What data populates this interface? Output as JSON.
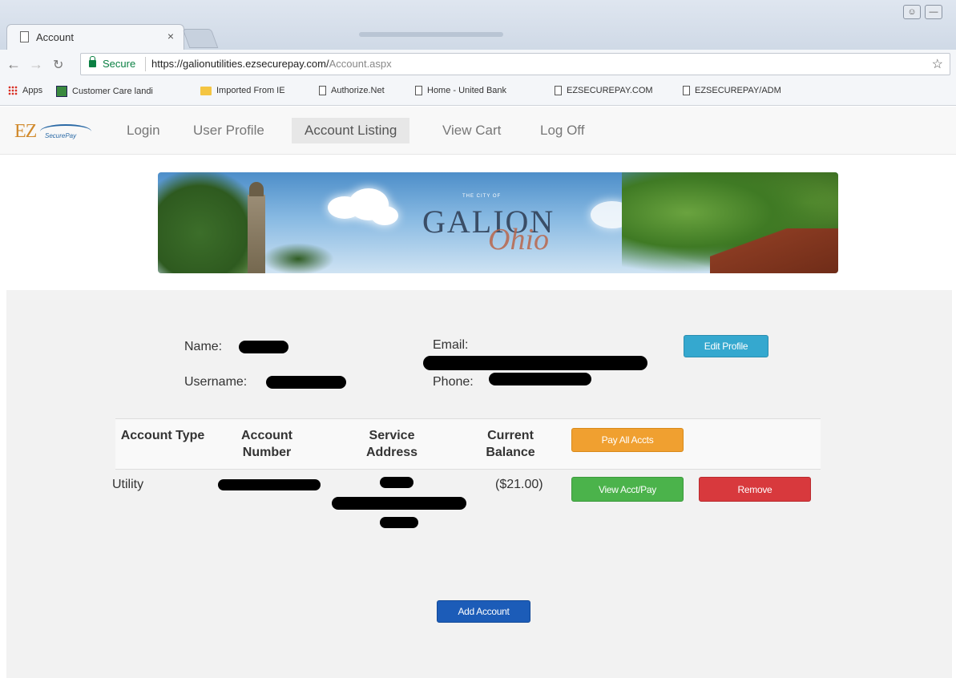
{
  "browser": {
    "tab_title": "Account",
    "tab_close": "×",
    "secure_label": "Secure",
    "url_main": "https://galionutilities.ezsecurepay.com/",
    "url_path": "Account.aspx",
    "bookmarks": [
      {
        "label": "Apps",
        "icon": "apps-grid-icon"
      },
      {
        "label": "Customer Care landi",
        "icon": "green-square-icon"
      },
      {
        "label": "Imported From IE",
        "icon": "folder-icon"
      },
      {
        "label": "Authorize.Net",
        "icon": "page-icon"
      },
      {
        "label": "Home - United Bank",
        "icon": "page-icon"
      },
      {
        "label": "EZSECUREPAY.COM",
        "icon": "page-icon"
      },
      {
        "label": "EZSECUREPAY/ADM",
        "icon": "page-icon"
      }
    ]
  },
  "site": {
    "logo_text": "EZ",
    "logo_sub": "SecurePay",
    "nav": [
      "Login",
      "User Profile",
      "Account Listing",
      "View Cart",
      "Log Off"
    ],
    "active_nav": "Account Listing"
  },
  "banner": {
    "city_of": "THE CITY OF",
    "city": "GALION",
    "state": "Ohio"
  },
  "profile": {
    "name_label": "Name:",
    "username_label": "Username:",
    "email_label": "Email:",
    "phone_label": "Phone:",
    "edit_button": "Edit Profile"
  },
  "accounts": {
    "headers": [
      "Account Type",
      "Account Number",
      "Service Address",
      "Current Balance"
    ],
    "pay_all_button": "Pay All Accts",
    "rows": [
      {
        "type": "Utility",
        "balance": "($21.00)",
        "view_button": "View Acct/Pay",
        "remove_button": "Remove"
      }
    ],
    "add_button": "Add Account"
  },
  "colors": {
    "info": "#35a8cf",
    "warning": "#f0a030",
    "success": "#4bb34b",
    "danger": "#d8393d",
    "primary": "#1c5cb8"
  }
}
